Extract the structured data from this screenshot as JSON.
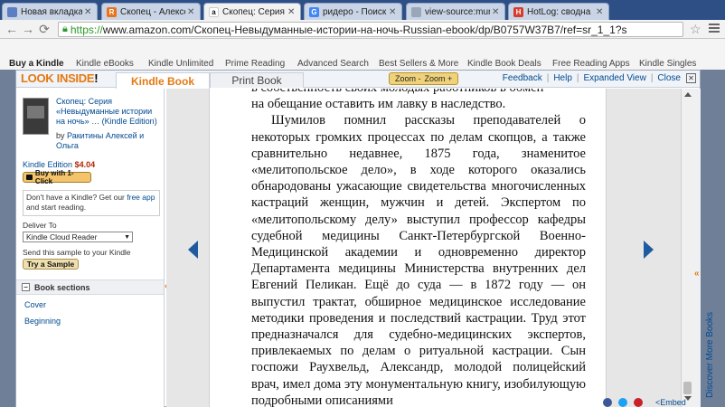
{
  "browser": {
    "tabs": [
      {
        "label": "Новая вкладка",
        "fav_color": "#5b7fc2",
        "fav_glyph": ""
      },
      {
        "label": "Скопец - Алексе",
        "fav_color": "#e8731a",
        "fav_glyph": "R"
      },
      {
        "label": "Скопец: Серия",
        "fav_color": "#ffffff",
        "fav_glyph": "a"
      },
      {
        "label": "ридеро - Поиск",
        "fav_color": "#4285f4",
        "fav_glyph": "G"
      },
      {
        "label": "view-source:mur",
        "fav_color": "#9aa7b8",
        "fav_glyph": ""
      },
      {
        "label": "HotLog: сводна",
        "fav_color": "#d83a2e",
        "fav_glyph": "H"
      }
    ],
    "url_protocol": "https://",
    "url_rest": "www.amazon.com/Скопец-Невыдуманные-истории-на-ночь-Russian-ebook/dp/B0757W37B7/ref=sr_1_1?s"
  },
  "amazon_nav": [
    "Buy a Kindle",
    "Kindle eBooks",
    "Kindle Unlimited",
    "Prime Reading",
    "Advanced Search",
    "Best Sellers & More",
    "Kindle Book Deals",
    "Free Reading Apps",
    "Kindle Singles"
  ],
  "dialog": {
    "logo_main": "LOOK INSIDE",
    "logo_excl": "!",
    "tab_kindle": "Kindle Book",
    "tab_print": "Print Book",
    "zoom_minus": "Zoom -",
    "zoom_plus": "Zoom +",
    "links": {
      "feedback": "Feedback",
      "help": "Help",
      "expanded": "Expanded View",
      "close": "Close"
    }
  },
  "book": {
    "title": "Скопец: Серия «Невыдуманные истории на ночь» …",
    "format": "(Kindle Edition)",
    "by": "by",
    "authors": "Ракитины Алексей и Ольга",
    "edition_label": "Kindle Edition",
    "price": "$4.04",
    "buy_label": "Buy with 1-Click",
    "nokindle_text": "Don't have a Kindle? Get our",
    "nokindle_link": "free app",
    "nokindle_tail": "and start reading.",
    "deliver_label": "Deliver To",
    "deliver_value": "Kindle Cloud Reader",
    "send_label": "Send this sample to your Kindle",
    "try_label": "Try a Sample",
    "sections_title": "Book sections",
    "sections": [
      "Cover",
      "Beginning"
    ]
  },
  "reader": {
    "top_partial": "в собственность своих молодых работников в обмен",
    "line2": "на обещание оставить им лавку в наследство.",
    "paragraph": "Шумилов помнил рассказы преподавателей о некоторых громких процессах по делам скопцов, а также сравнительно недавнее, 1875 года, знаменитое «мелитопольское дело», в ходе которого оказались обнародованы ужасающие свидетельства многочисленных кастраций женщин, мужчин и детей. Экспертом по «мелитопольскому делу» выступил профессор кафедры судебной медицины Санкт-Петербургской Военно-Медицинской академии и одновременно директор Департамента медицины Министерства внутренних дел Евгений Пеликан. Ещё до суда — в 1872 году — он выпустил трактат, обширное медицинское исследование методики проведения и последствий кастрации. Труд этот предназначался для судебно-медицинских экспертов, привлекаемых по делам о ритуальной кастрации. Сын госпожи Раухвельд, Александр, молодой полицейский врач, имел дома эту монументальную книгу, изобилующую подробными описаниями"
  },
  "discover": "Discover More Books",
  "embed": "<Embed"
}
